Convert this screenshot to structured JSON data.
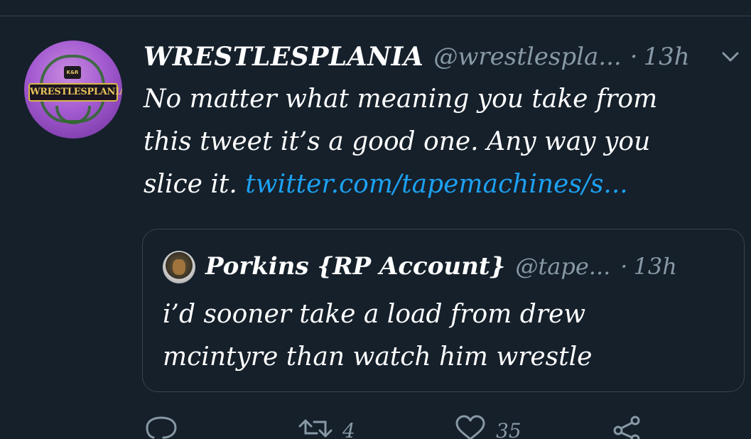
{
  "tweet": {
    "display_name": "WRESTLESPLANIA",
    "handle": "@wrestlespla...",
    "separator": "·",
    "time": "13h",
    "text_line1": "No matter what meaning you take from",
    "text_line2": "this tweet it’s a good one. Any way you",
    "text_line3_plain": "slice it. ",
    "text_link": "twitter.com/tapemachines/s...",
    "avatar": {
      "crest_text": "K&R",
      "logo_text": "WRESTLESPLANIA"
    }
  },
  "quoted_tweet": {
    "display_name": "Porkins {RP Account}",
    "handle": "@tape...",
    "separator": "·",
    "time": "13h",
    "text_line1": "i’d sooner take a load from drew",
    "text_line2": "mcintyre than watch him wrestle"
  },
  "actions": {
    "reply_count": "",
    "retweet_count": "4",
    "like_count": "35"
  },
  "colors": {
    "background": "#15202b",
    "secondary_text": "#8899a6",
    "link": "#1da1f2",
    "border": "#38444d"
  },
  "icons": {
    "menu": "chevron-down-icon",
    "reply": "reply-icon",
    "retweet": "retweet-icon",
    "like": "heart-icon",
    "share": "share-icon"
  }
}
